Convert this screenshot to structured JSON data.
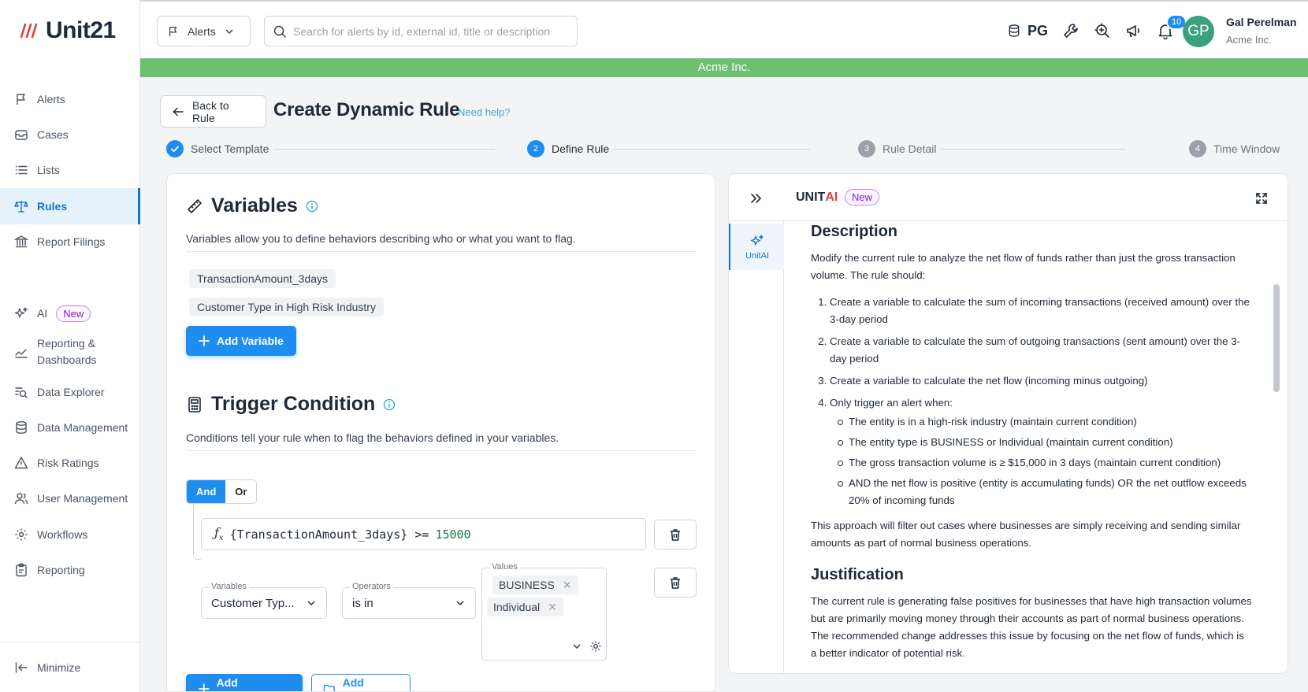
{
  "app": {
    "logo_text": "Unit21",
    "module_select": "Alerts",
    "search_placeholder": "Search for alerts by id, external id, title or description",
    "env_label": "PG",
    "notification_count": "10",
    "user": {
      "initials": "GP",
      "name": "Gal Perelman",
      "org": "Acme Inc."
    },
    "org_banner": "Acme Inc.",
    "colors": {
      "accent": "#1d8df0",
      "banner": "#6cc070",
      "avatar": "#3aa17e"
    }
  },
  "sidebar": {
    "items": [
      {
        "label": "Alerts",
        "icon": "flag-icon"
      },
      {
        "label": "Cases",
        "icon": "inbox-icon"
      },
      {
        "label": "Lists",
        "icon": "list-icon"
      },
      {
        "label": "Rules",
        "icon": "scale-icon"
      },
      {
        "label": "Report Filings",
        "icon": "bank-icon"
      },
      {
        "label": "AI",
        "icon": "sparkle-icon",
        "badge": "New"
      },
      {
        "label": "Reporting &",
        "label2": "Dashboards",
        "icon": "chart-icon"
      },
      {
        "label": "Data Explorer",
        "icon": "data-search-icon"
      },
      {
        "label": "Data Management",
        "icon": "database-icon"
      },
      {
        "label": "Risk Ratings",
        "icon": "warning-icon"
      },
      {
        "label": "User Management",
        "icon": "users-icon"
      },
      {
        "label": "Workflows",
        "icon": "workflow-icon"
      },
      {
        "label": "Reporting",
        "icon": "clipboard-icon"
      }
    ],
    "minimize_label": "Minimize"
  },
  "header": {
    "back_label": "Back to Rule",
    "title": "Create Dynamic Rule",
    "help_link": "Need help?"
  },
  "stepper": {
    "steps": [
      {
        "number": "1",
        "label": "Select Template",
        "state": "done"
      },
      {
        "number": "2",
        "label": "Define Rule",
        "state": "current"
      },
      {
        "number": "3",
        "label": "Rule Detail",
        "state": "todo"
      },
      {
        "number": "4",
        "label": "Time Window",
        "state": "todo"
      }
    ]
  },
  "variables": {
    "title": "Variables",
    "description": "Variables allow you to define behaviors describing who or what you want to flag.",
    "items": [
      "TransactionAmount_3days",
      "Customer Type in High Risk Industry"
    ],
    "add_label": "Add Variable"
  },
  "trigger": {
    "title": "Trigger Condition",
    "description": "Conditions tell your rule when to flag the behaviors defined in your variables.",
    "logic_and": "And",
    "logic_or": "Or",
    "formula_prefix": "{TransactionAmount_3days} >=",
    "formula_value": "15000",
    "variable_label": "Variables",
    "variable_value": "Customer Typ...",
    "operator_label": "Operators",
    "operator_value": "is in",
    "values_label": "Values",
    "values": [
      "BUSINESS",
      "Individual"
    ],
    "add_condition_label": "Add Condition",
    "add_group_label": "Add Group"
  },
  "unitai": {
    "brand_prefix": "UNIT",
    "brand_suffix": "AI",
    "badge": "New",
    "side_tab_label": "UnitAI",
    "description_heading": "Description",
    "description_intro": "Modify the current rule to analyze the net flow of funds rather than just the gross transaction volume. The rule should:",
    "steps": [
      "Create a variable to calculate the sum of incoming transactions (received amount) over the 3-day period",
      "Create a variable to calculate the sum of outgoing transactions (sent amount) over the 3-day period",
      "Create a variable to calculate the net flow (incoming minus outgoing)",
      "Only trigger an alert when:"
    ],
    "sub_conditions": [
      "The entity is in a high-risk industry (maintain current condition)",
      "The entity type is BUSINESS or Individual (maintain current condition)",
      "The gross transaction volume is ≥ $15,000 in 3 days (maintain current condition)",
      "AND the net flow is positive (entity is accumulating funds) OR the net outflow exceeds 20% of incoming funds"
    ],
    "approach": "This approach will filter out cases where businesses are simply receiving and sending similar amounts as part of normal business operations.",
    "justification_heading": "Justification",
    "justification": "The current rule is generating false positives for businesses that have high transaction volumes but are primarily moving money through their accounts as part of normal business operations. The recommended change addresses this issue by focusing on the net flow of funds, which is a better indicator of potential risk."
  }
}
